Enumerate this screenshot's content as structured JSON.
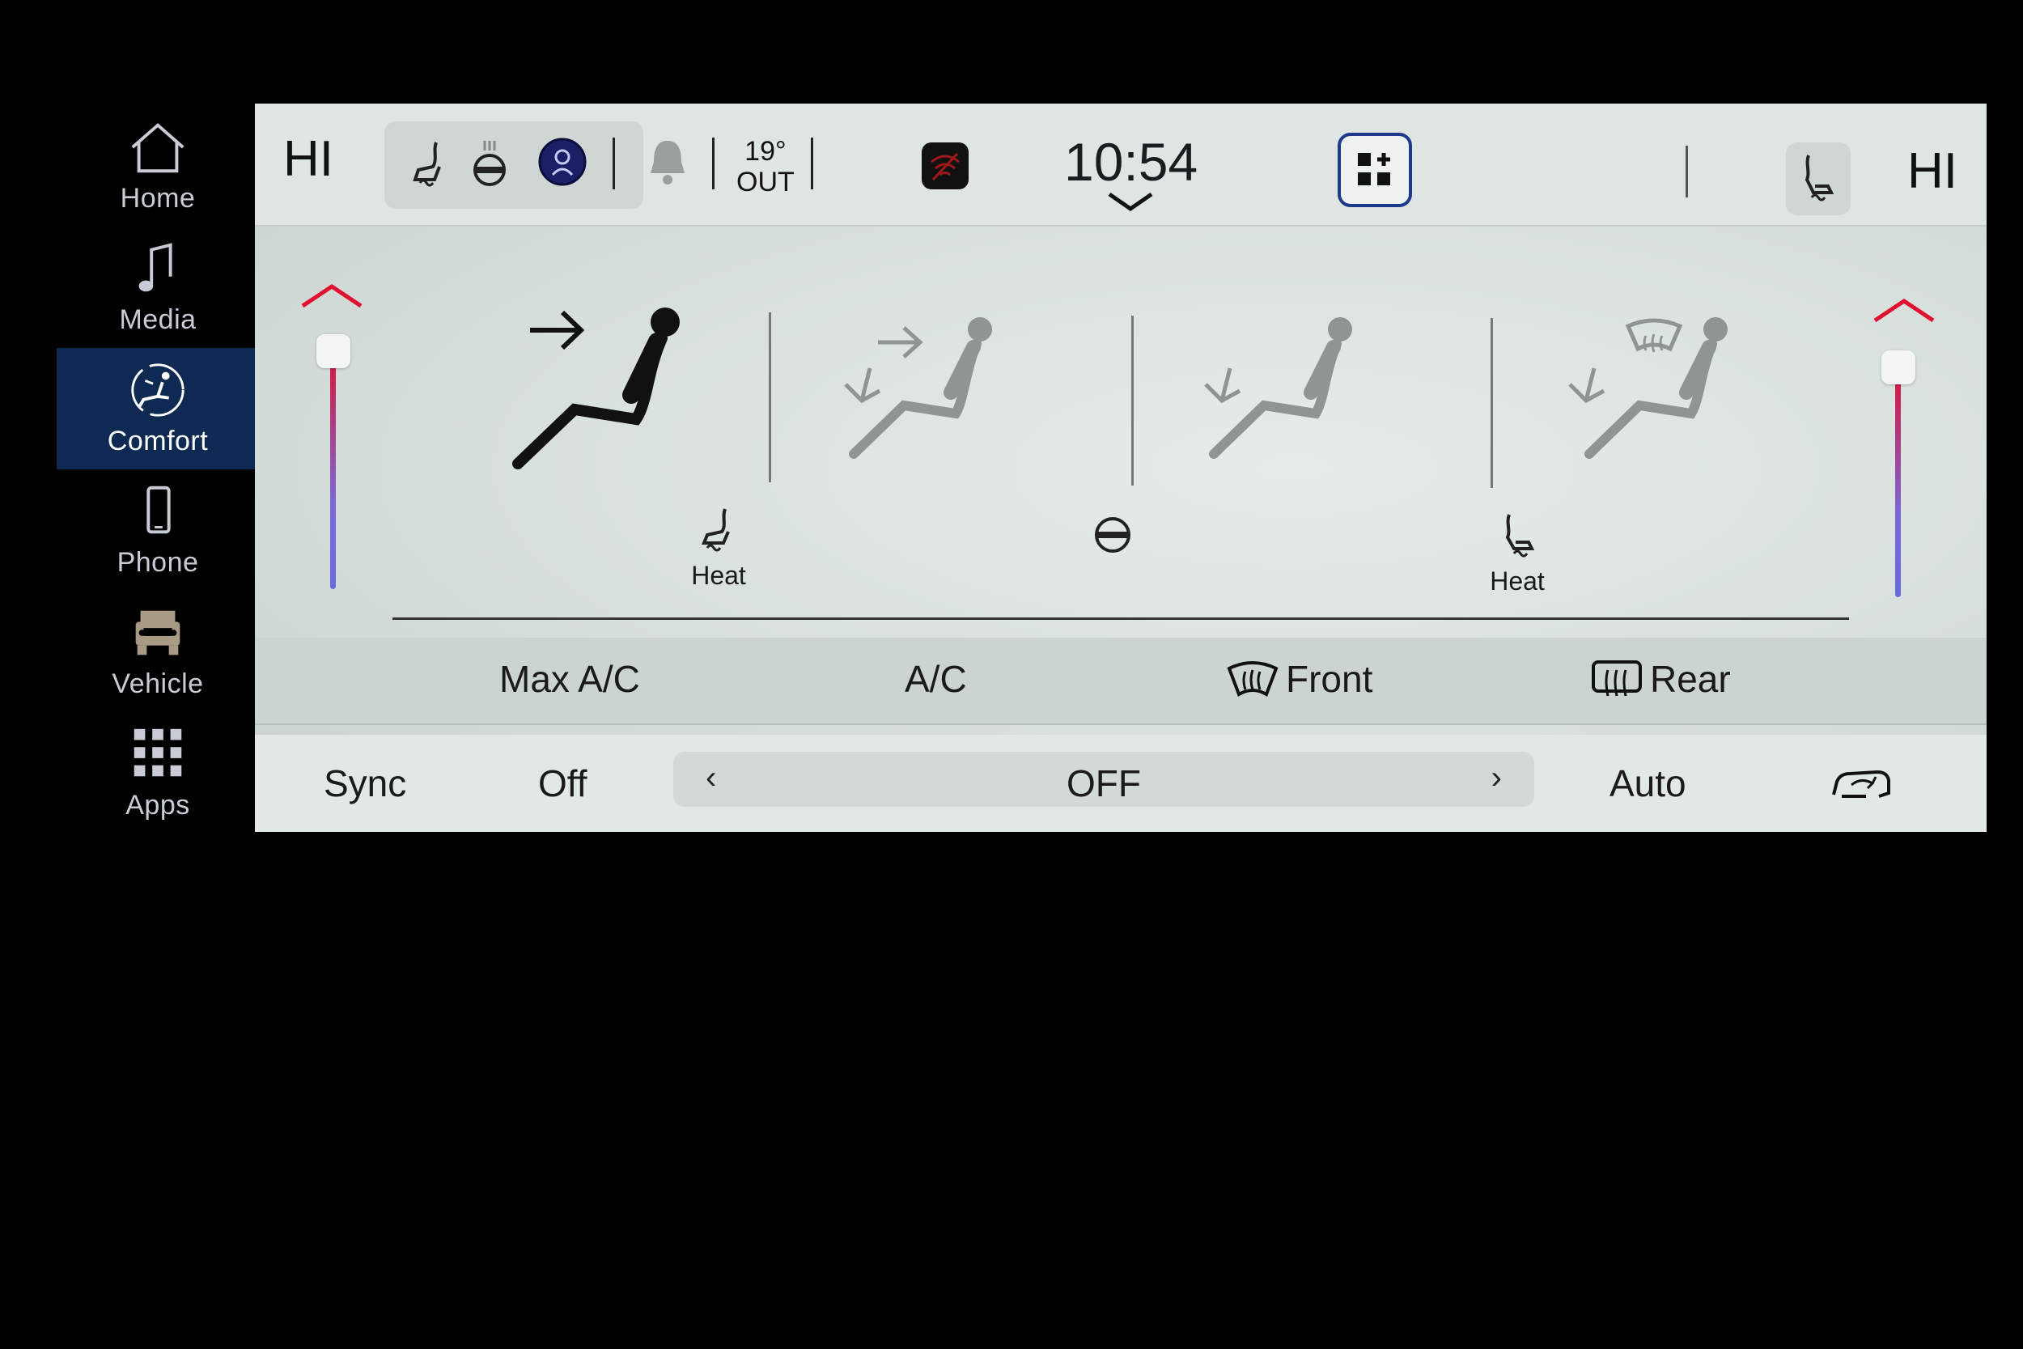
{
  "nav": {
    "items": [
      {
        "label": "Home",
        "icon": "home-icon"
      },
      {
        "label": "Media",
        "icon": "music-note-icon"
      },
      {
        "label": "Comfort",
        "icon": "comfort-seat-icon",
        "active": true
      },
      {
        "label": "Phone",
        "icon": "phone-icon"
      },
      {
        "label": "Vehicle",
        "icon": "jeep-icon"
      },
      {
        "label": "Apps",
        "icon": "apps-grid-icon"
      }
    ]
  },
  "topbar": {
    "driver_temp": "HI",
    "passenger_temp": "HI",
    "outside_temp": "19°",
    "outside_label": "OUT",
    "clock": "10:54",
    "icons": [
      "heated-seat-icon",
      "heated-steering-wheel-icon",
      "driver-profile-icon",
      "notification-bell-icon",
      "wifi-off-icon",
      "add-widget-icon",
      "passenger-seat-icon",
      "chevron-down-icon"
    ]
  },
  "modes": {
    "driver_heat_label": "Heat",
    "passenger_heat_label": "Heat",
    "items": [
      "panel-mode",
      "bi-level-mode",
      "floor-mode",
      "defrost-floor-mode"
    ]
  },
  "controls": {
    "max_ac": "Max A/C",
    "ac": "A/C",
    "front_defrost": "Front",
    "rear_defrost": "Rear"
  },
  "fan": {
    "sync": "Sync",
    "off": "Off",
    "left_arrow": "‹",
    "value": "OFF",
    "right_arrow": "›",
    "auto": "Auto"
  },
  "colors": {
    "accent_active": "#0e2a52",
    "hot": "#e01030",
    "cold": "#6a6ae0"
  }
}
